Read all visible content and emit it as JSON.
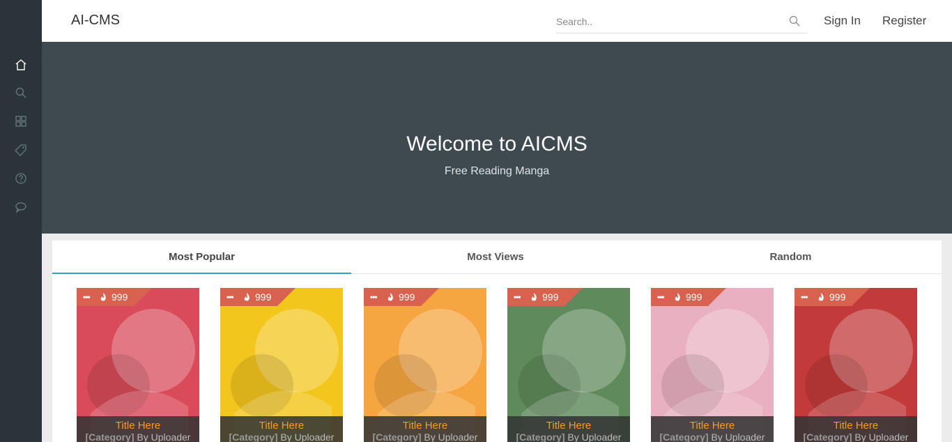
{
  "brand": "AI-CMS",
  "search": {
    "placeholder": "Search.."
  },
  "nav": {
    "sign_in": "Sign In",
    "register": "Register"
  },
  "sidebar": {
    "items": [
      {
        "icon": "home-icon",
        "active": true
      },
      {
        "icon": "search-icon",
        "active": false
      },
      {
        "icon": "grid-icon",
        "active": false
      },
      {
        "icon": "tag-icon",
        "active": false
      },
      {
        "icon": "help-icon",
        "active": false
      },
      {
        "icon": "chat-icon",
        "active": false
      }
    ]
  },
  "hero": {
    "title": "Welcome to AICMS",
    "subtitle": "Free Reading Manga"
  },
  "tabs": [
    {
      "label": "Most Popular",
      "active": true
    },
    {
      "label": "Most Views",
      "active": false
    },
    {
      "label": "Random",
      "active": false
    }
  ],
  "cards": [
    {
      "count": "999",
      "title": "Title Here",
      "category": "[Category]",
      "by": "By Uploader",
      "cover": "#d94b5a"
    },
    {
      "count": "999",
      "title": "Title Here",
      "category": "[Category]",
      "by": "By Uploader",
      "cover": "#f3c61d"
    },
    {
      "count": "999",
      "title": "Title Here",
      "category": "[Category]",
      "by": "By Uploader",
      "cover": "#f6a640"
    },
    {
      "count": "999",
      "title": "Title Here",
      "category": "[Category]",
      "by": "By Uploader",
      "cover": "#5f8a5b"
    },
    {
      "count": "999",
      "title": "Title Here",
      "category": "[Category]",
      "by": "By Uploader",
      "cover": "#e8b0c0"
    },
    {
      "count": "999",
      "title": "Title Here",
      "category": "[Category]",
      "by": "By Uploader",
      "cover": "#c23a3a"
    }
  ],
  "colors": {
    "accent": "#2aa4c4",
    "badge": "#d9614f",
    "title": "#f0a020",
    "hero": "#3e4a50",
    "sidebar": "#2b3438"
  }
}
